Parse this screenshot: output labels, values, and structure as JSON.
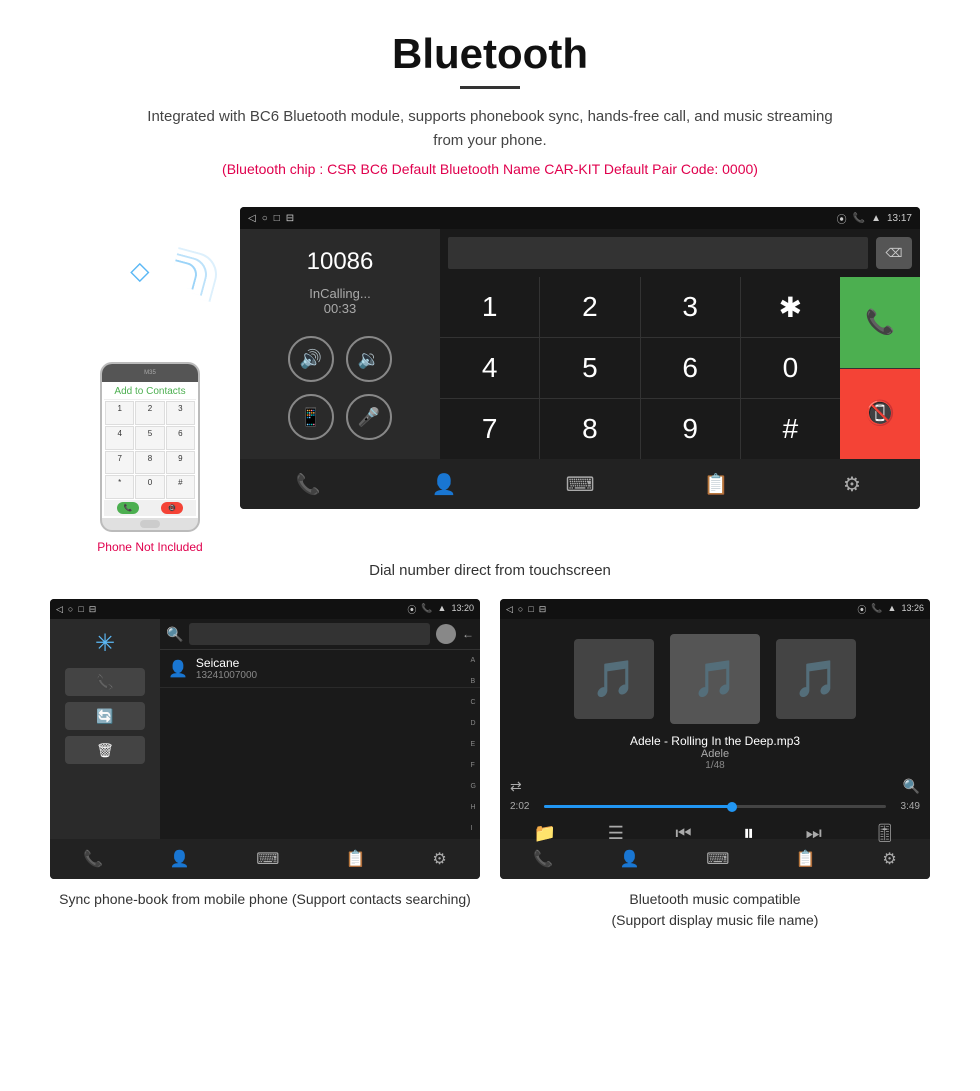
{
  "page": {
    "title": "Bluetooth",
    "subtitle": "Integrated with BC6 Bluetooth module, supports phonebook sync, hands-free call, and music streaming from your phone.",
    "specs": "(Bluetooth chip : CSR BC6    Default Bluetooth Name CAR-KIT    Default Pair Code: 0000)",
    "main_caption": "Dial number direct from touchscreen",
    "phone_not_included": "Phone Not Included"
  },
  "dialer": {
    "number": "10086",
    "status": "InCalling...",
    "timer": "00:33",
    "statusbar_time": "13:17",
    "keys": [
      "1",
      "2",
      "3",
      "*",
      "4",
      "5",
      "6",
      "0",
      "7",
      "8",
      "9",
      "#"
    ]
  },
  "phonebook": {
    "statusbar_time": "13:20",
    "contact_name": "Seicane",
    "contact_number": "13241007000",
    "caption": "Sync phone-book from mobile phone\n(Support contacts searching)",
    "alphabet": [
      "A",
      "B",
      "C",
      "D",
      "E",
      "F",
      "G",
      "H",
      "I"
    ]
  },
  "music": {
    "statusbar_time": "13:26",
    "track_name": "Adele - Rolling In the Deep.mp3",
    "artist": "Adele",
    "track_count": "1/48",
    "time_current": "2:02",
    "time_total": "3:49",
    "progress_percent": 55,
    "caption": "Bluetooth music compatible\n(Support display music file name)"
  },
  "bottomnav_icons": {
    "call_transfer": "📞",
    "contacts": "👤",
    "keypad": "⌨",
    "transfer": "📋",
    "settings": "⚙"
  }
}
